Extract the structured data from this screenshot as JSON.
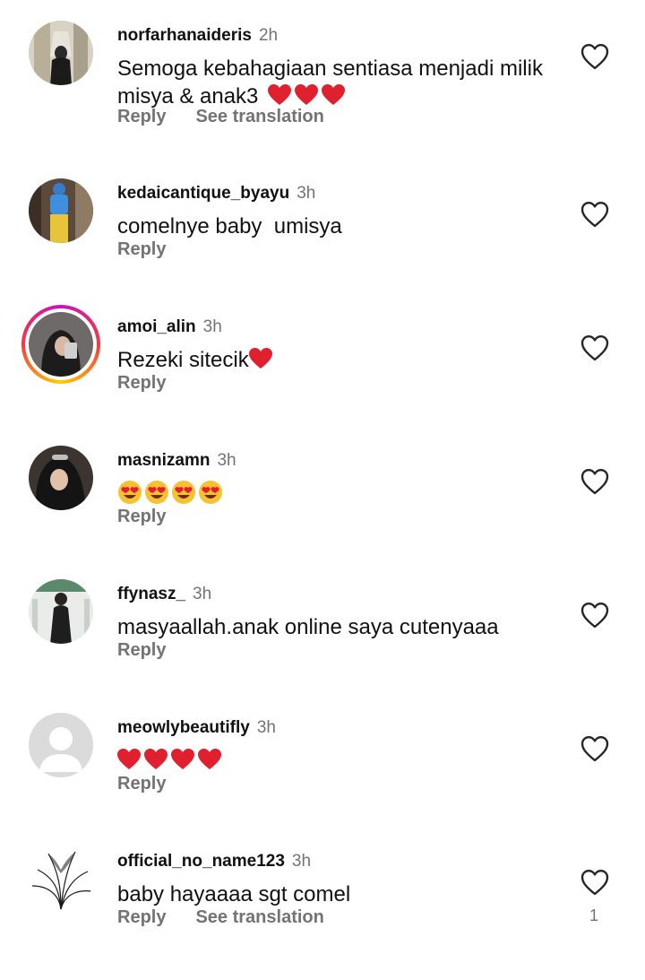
{
  "comments": [
    {
      "username": "norfarhanaideris",
      "time": "2h",
      "text": "Semoga kebahagiaan sentiasa menjadi milik misya & anak3",
      "emoji": "❤️❤️❤️",
      "reply": "Reply",
      "translate": "See translation"
    },
    {
      "username": "kedaicantique_byayu",
      "time": "3h",
      "text": "comelnye baby  umisya",
      "reply": "Reply"
    },
    {
      "username": "amoi_alin",
      "time": "3h",
      "text": "Rezeki sitecik",
      "emoji": "❤️",
      "reply": "Reply"
    },
    {
      "username": "masnizamn",
      "time": "3h",
      "text": "",
      "emoji": "😍😍😍😍",
      "reply": "Reply"
    },
    {
      "username": "ffynasz_",
      "time": "3h",
      "text": "masyaallah.anak online saya cutenyaaa",
      "reply": "Reply"
    },
    {
      "username": "meowlybeautifly",
      "time": "3h",
      "text": "",
      "emoji": "❤️❤️❤️❤️",
      "reply": "Reply"
    },
    {
      "username": "official_no_name123",
      "time": "3h",
      "text": "baby hayaaaa sgt comel",
      "reply": "Reply",
      "translate": "See translation",
      "likes": "1"
    }
  ],
  "icons": {
    "like": "heart-outline-icon"
  },
  "colors": {
    "secondary_text": "#737373",
    "heart_red": "#e0202e"
  }
}
